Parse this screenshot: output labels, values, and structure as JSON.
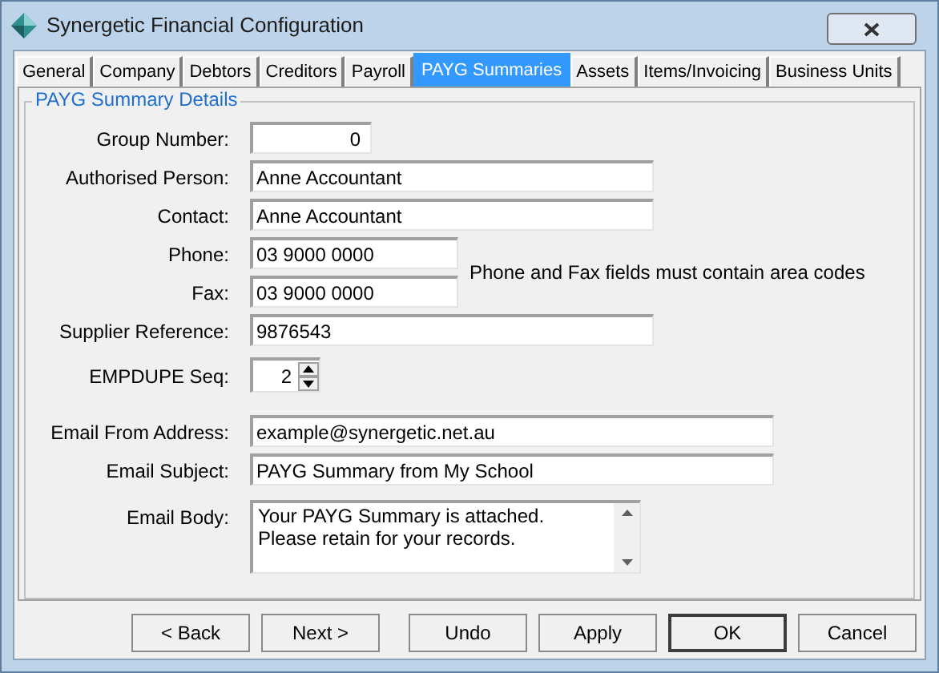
{
  "window": {
    "title": "Synergetic Financial Configuration"
  },
  "tabs": [
    {
      "label": "General",
      "selected": false
    },
    {
      "label": "Company",
      "selected": false
    },
    {
      "label": "Debtors",
      "selected": false
    },
    {
      "label": "Creditors",
      "selected": false
    },
    {
      "label": "Payroll",
      "selected": false
    },
    {
      "label": "PAYG Summaries",
      "selected": true
    },
    {
      "label": "Assets",
      "selected": false
    },
    {
      "label": "Items/Invoicing",
      "selected": false
    },
    {
      "label": "Business Units",
      "selected": false
    }
  ],
  "group": {
    "title": "PAYG Summary Details",
    "rows": [
      {
        "kind": "number",
        "label": "Group Number:",
        "value": "0"
      },
      {
        "kind": "text",
        "label": "Authorised Person:",
        "value": "Anne Accountant"
      },
      {
        "kind": "text",
        "label": "Contact:",
        "value": "Anne Accountant"
      },
      {
        "kind": "pair",
        "note": "Phone and Fax fields must contain area codes",
        "fields": [
          {
            "label": "Phone:",
            "value": "03 9000 0000"
          },
          {
            "label": "Fax:",
            "value": "03 9000 0000"
          }
        ]
      },
      {
        "kind": "text",
        "label": "Supplier Reference:",
        "value": "9876543"
      },
      {
        "kind": "spinner",
        "label": "EMPDUPE Seq:",
        "value": "2"
      },
      {
        "kind": "email",
        "label": "Email From Address:",
        "value": "example@synergetic.net.au"
      },
      {
        "kind": "email",
        "label": "Email Subject:",
        "value": "PAYG Summary from My School"
      },
      {
        "kind": "textarea",
        "label": "Email Body:",
        "value": "Your PAYG Summary is attached.\nPlease retain for your records."
      }
    ]
  },
  "buttons": [
    {
      "label": "< Back",
      "default": false
    },
    {
      "label": "Next >",
      "default": false
    },
    {
      "label": "Undo",
      "default": false
    },
    {
      "label": "Apply",
      "default": false
    },
    {
      "label": "OK",
      "default": true
    },
    {
      "label": "Cancel",
      "default": false
    }
  ]
}
